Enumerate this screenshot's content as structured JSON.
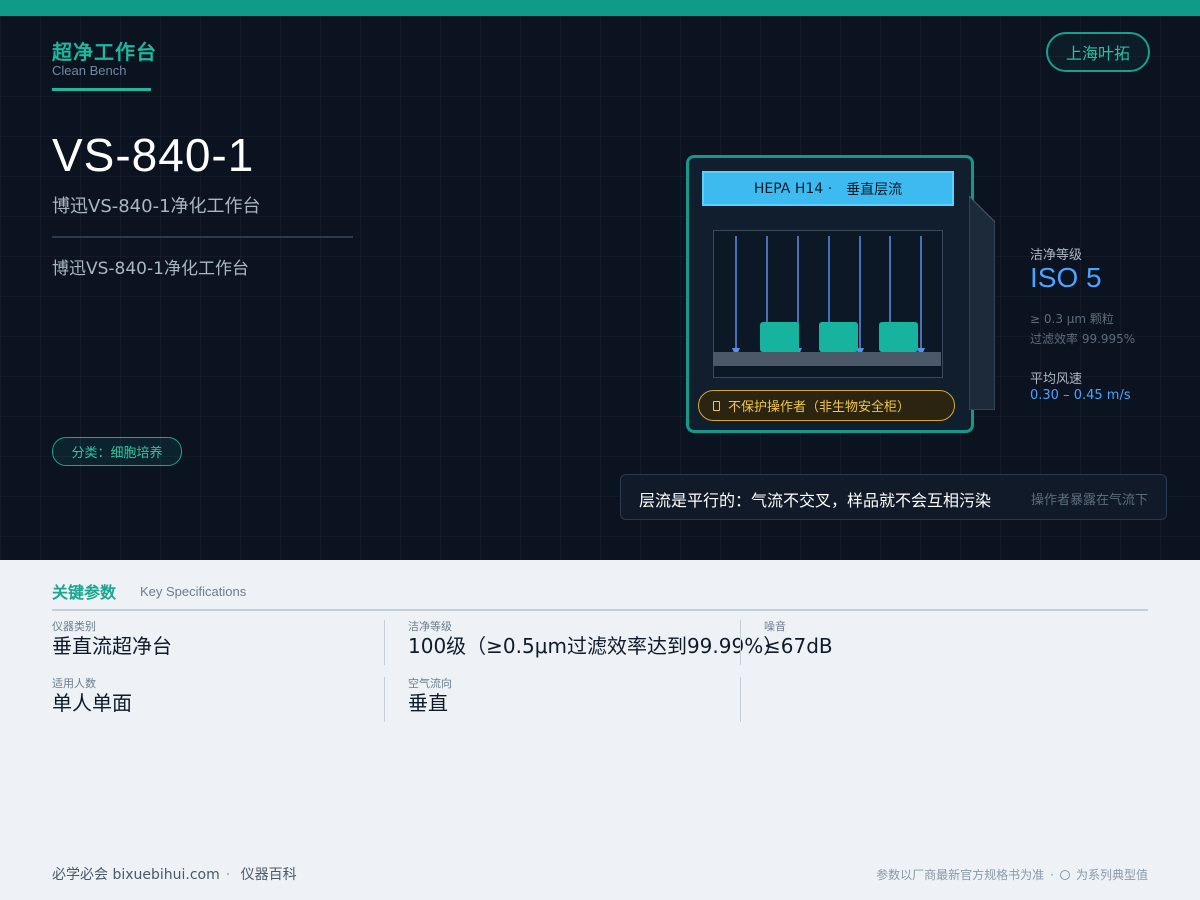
{
  "header": {
    "category": "超净工作台",
    "category_en": "Clean Bench",
    "brand": "上海叶拓"
  },
  "product": {
    "model": "VS-840-1",
    "subtitle": "博迅VS-840-1净化工作台",
    "description": "博迅VS-840-1净化工作台",
    "badge": "分类：细胞培养"
  },
  "diagram": {
    "hepa_label": "HEPA H14 ·",
    "flow_label": "垂直层流",
    "warning": "不保护操作者（非生物安全柜）",
    "sample_count": 3
  },
  "cleanliness": {
    "label": "洁净等级",
    "value": "ISO 5",
    "note1": "≥ 0.3 μm 颗粒",
    "note2": "过滤效率 99.995%",
    "speed_label": "平均风速",
    "speed_value": "0.30 – 0.45 m/s"
  },
  "caption": {
    "main": "层流是平行的：气流不交叉，样品就不会互相污染",
    "sub": "操作者暴露在气流下"
  },
  "specs": {
    "title": "关键参数",
    "title_en": "Key Specifications",
    "items": [
      {
        "label": "仪器类别",
        "value": "垂直流超净台"
      },
      {
        "label": "洁净等级",
        "value": "100级（≥0.5μm过滤效率达到99.99%）"
      },
      {
        "label": "噪音",
        "value": "≤67dB"
      },
      {
        "label": "适用人数",
        "value": "单人单面"
      },
      {
        "label": "空气流向",
        "value": "垂直"
      }
    ]
  },
  "footer": {
    "site": "必学必会 bixuebihui.com",
    "section": "仪器百科",
    "note": "参数以厂商最新官方规格书为准",
    "legend": "为系列典型值"
  },
  "colors": {
    "accent": "#109b88",
    "hero_bg": "#0b1220",
    "hepa": "#3dbbf0",
    "warning": "#f2c64a",
    "iso_blue": "#4aa3ff"
  }
}
